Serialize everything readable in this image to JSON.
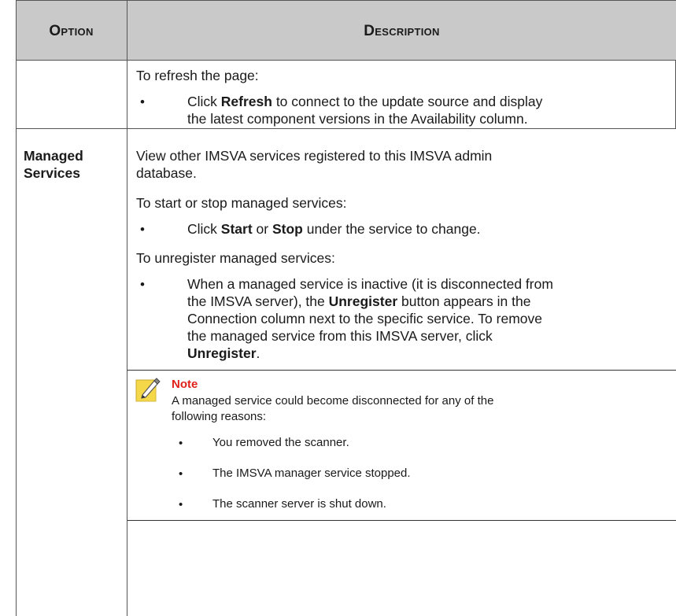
{
  "header": {
    "option": "Option",
    "description": "Description"
  },
  "row1": {
    "intro": "To refresh the page:",
    "bullet_pre": "Click ",
    "bullet_bold": "Refresh",
    "bullet_line1_rest": " to connect to the update source and display",
    "bullet_line2": "the latest component versions in the Availability column."
  },
  "row2": {
    "option_line1": "Managed",
    "option_line2": "Services",
    "desc_line1": "View other IMSVA services registered to this IMSVA admin",
    "desc_line2": "database.",
    "start_stop_intro": "To start or stop managed services:",
    "ss_pre": "Click ",
    "ss_bold1": "Start",
    "ss_mid": " or ",
    "ss_bold2": "Stop",
    "ss_rest": " under the service to change.",
    "unreg_intro": "To unregister managed services:",
    "unreg_l1": "When a managed service is inactive (it is disconnected from",
    "unreg_l2_pre": "the IMSVA server), the ",
    "unreg_l2_bold": "Unregister",
    "unreg_l2_rest": " button appears in the",
    "unreg_l3": "Connection column next to the specific service. To remove",
    "unreg_l4": "the managed service from this IMSVA server, click",
    "unreg_l5_bold": "Unregister",
    "unreg_l5_rest": "."
  },
  "note": {
    "title": "Note",
    "line1": "A managed service could become disconnected for any of the",
    "line2": "following reasons:",
    "items": [
      "You removed the scanner.",
      "The IMSVA manager service stopped.",
      "The scanner server is shut down."
    ]
  },
  "icons": {
    "bullet": "bullet-icon",
    "note": "note-pencil-icon"
  },
  "colors": {
    "header_bg": "#c9c9c9",
    "note_title": "#e0211b"
  }
}
